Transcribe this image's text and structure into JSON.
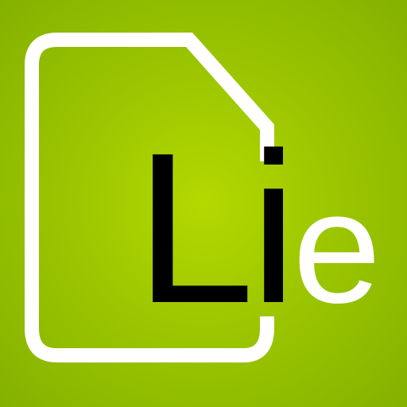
{
  "icon": {
    "name": "document-icon",
    "background_color": "#9cc600",
    "outline_color": "#ffffff"
  },
  "logo": {
    "letter_1": "L",
    "letter_2": "i",
    "letter_3": "e",
    "dark_color": "#000000",
    "light_color": "#ffffff"
  }
}
